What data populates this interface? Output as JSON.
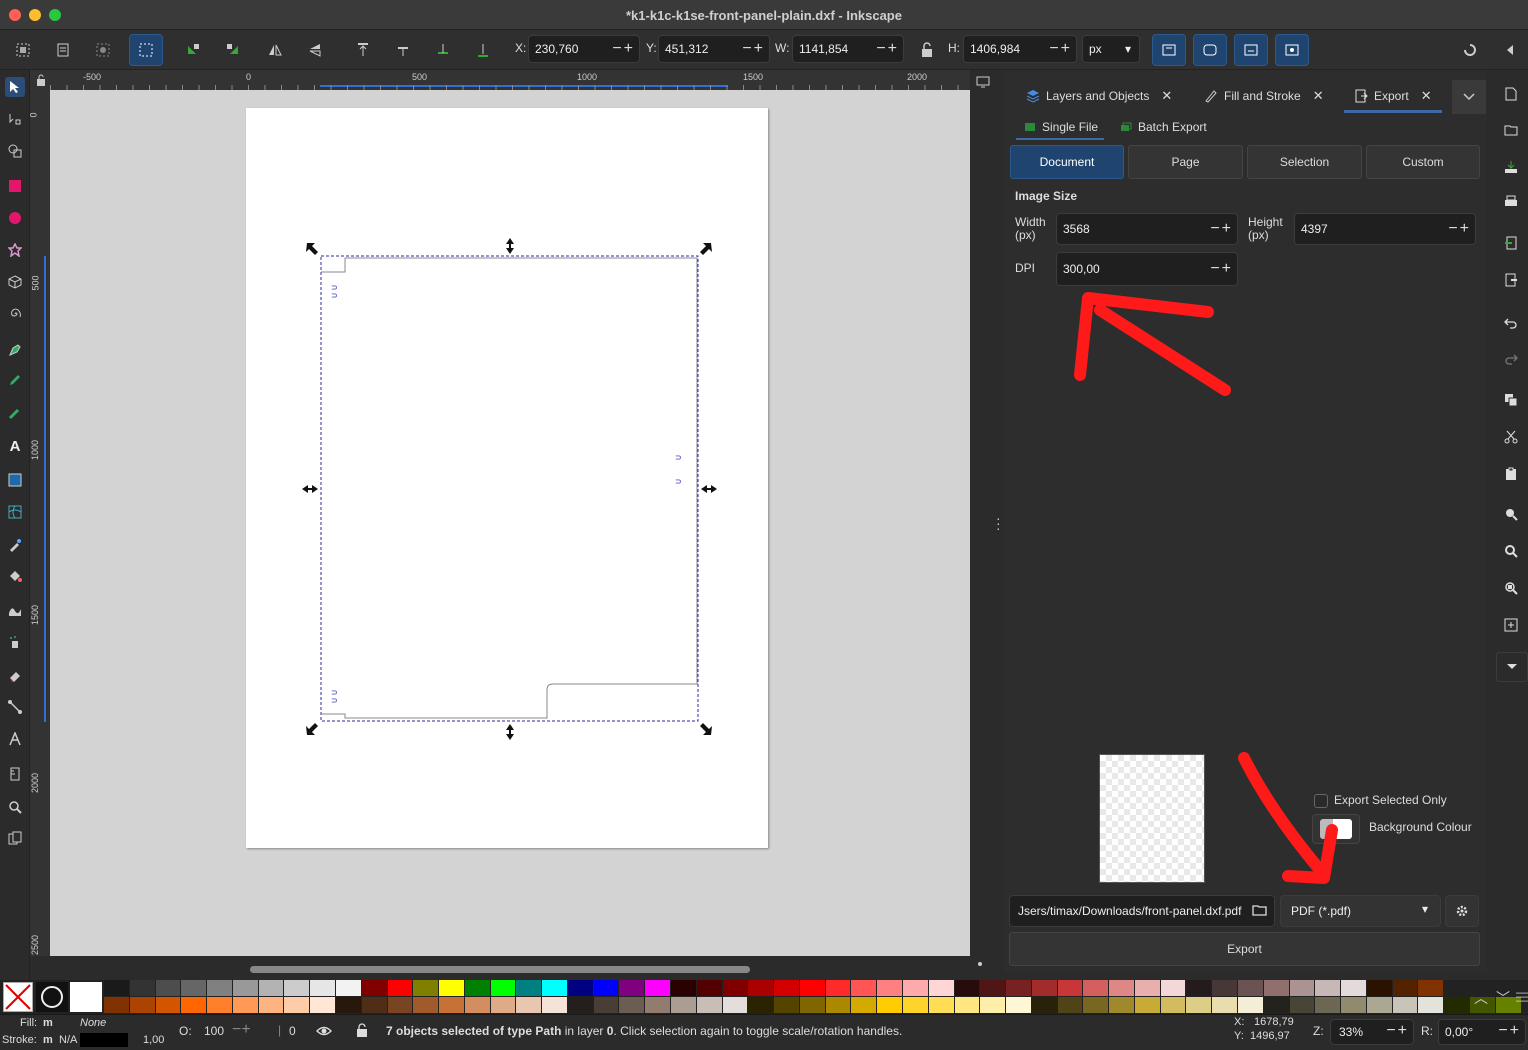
{
  "window": {
    "title": "*k1-k1c-k1se-front-panel-plain.dxf - Inkscape"
  },
  "toolbar": {
    "x_label": "X:",
    "x_value": "230,760",
    "y_label": "Y:",
    "y_value": "451,312",
    "w_label": "W:",
    "w_value": "1141,854",
    "h_label": "H:",
    "h_value": "1406,984",
    "unit": "px"
  },
  "ruler": {
    "top_ticks": [
      "-500",
      "0",
      "500",
      "1000",
      "1500",
      "2000"
    ],
    "left_ticks": [
      "0",
      "500",
      "1000",
      "1500",
      "2000",
      "2500"
    ]
  },
  "dock": {
    "tabs": [
      {
        "label": "Layers and Objects"
      },
      {
        "label": "Fill and Stroke"
      },
      {
        "label": "Export"
      }
    ],
    "subtabs": [
      {
        "label": "Single File"
      },
      {
        "label": "Batch Export"
      }
    ],
    "area_buttons": [
      {
        "label": "Document"
      },
      {
        "label": "Page"
      },
      {
        "label": "Selection"
      },
      {
        "label": "Custom"
      }
    ],
    "image_size_heading": "Image Size",
    "width_label": "Width",
    "width_unit": "(px)",
    "width_value": "3568",
    "height_label": "Height",
    "height_unit": "(px)",
    "height_value": "4397",
    "dpi_label": "DPI",
    "dpi_value": "300,00",
    "export_selected_only": "Export Selected Only",
    "background_colour": "Background Colour",
    "filename": "Jsers/timax/Downloads/front-panel.dxf.pdf",
    "format": "PDF (*.pdf)",
    "export_button": "Export"
  },
  "status": {
    "fill_label": "Fill:",
    "fill_value": "m",
    "fill_none": "None",
    "stroke_label": "Stroke:",
    "stroke_value": "m",
    "stroke_na": "N/A",
    "stroke_width": "1,00",
    "opacity_label": "O:",
    "opacity_value": "100",
    "layer_count": "0",
    "message_pre": "7 objects selected of type ",
    "message_type": "Path",
    "message_mid": " in layer ",
    "message_layer": "0",
    "message_post": ". Click selection again to toggle scale/rotation handles.",
    "cursor_x": "1678,79",
    "cursor_y": "1496,97",
    "zoom_label": "Z:",
    "zoom_value": "33%",
    "rotate_label": "R:",
    "rotate_value": "0,00°"
  },
  "colors": {
    "accent": "#2c4d78",
    "annotation_red": "#ff1a1a"
  }
}
